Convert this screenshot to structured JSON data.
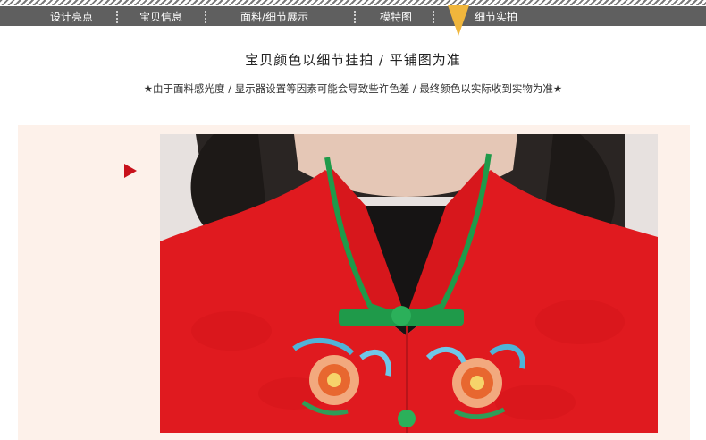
{
  "nav": {
    "items": [
      {
        "label": "设计亮点"
      },
      {
        "label": "宝贝信息"
      },
      {
        "label": "面料/细节展示"
      },
      {
        "label": "模特图"
      },
      {
        "label": "细节实拍"
      }
    ],
    "active_index": 4,
    "pointer_color": "#f0b63c"
  },
  "heading": "宝贝颜色以细节挂拍 / 平铺图为准",
  "note": "★由于面料感光度 / 显示器设置等因素可能会导致些许色差 / 最终颜色以实际收到实物为准★",
  "colors": {
    "nav_bar": "#5f5f5f",
    "accent_red": "#c8111b",
    "garment_red": "#e01a1f",
    "trim_green": "#1f9a4a",
    "panel_bg": "#fdf1ea"
  },
  "icons": {
    "nav_pointer": "down-triangle",
    "section_marker": "right-triangle"
  }
}
